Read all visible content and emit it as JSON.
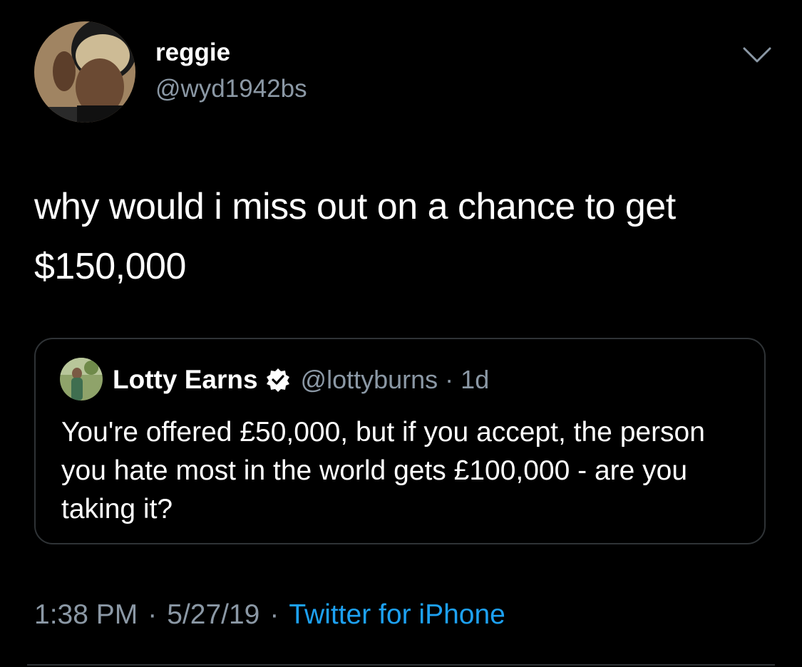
{
  "tweet": {
    "author": {
      "display_name": "reggie",
      "handle": "@wyd1942bs",
      "avatar_icon": "user-avatar-photo"
    },
    "menu_icon": "chevron-down-icon",
    "text": "why would i miss out on a chance to get $150,000",
    "quoted": {
      "display_name": "Lotty Earns",
      "verified_icon": "verified-badge-icon",
      "handle": "@lottyburns",
      "separator": "·",
      "age": "1d",
      "text": "You're offered £50,000, but if you accept, the person you hate most in the world gets £100,000 - are you taking it?"
    },
    "meta": {
      "time": "1:38 PM",
      "separator": "·",
      "date": "5/27/19",
      "source": "Twitter for iPhone"
    }
  },
  "colors": {
    "background": "#000000",
    "primary_text": "#ffffff",
    "secondary_text": "#8b98a5",
    "link": "#1da1f2",
    "border": "#2f3336"
  }
}
